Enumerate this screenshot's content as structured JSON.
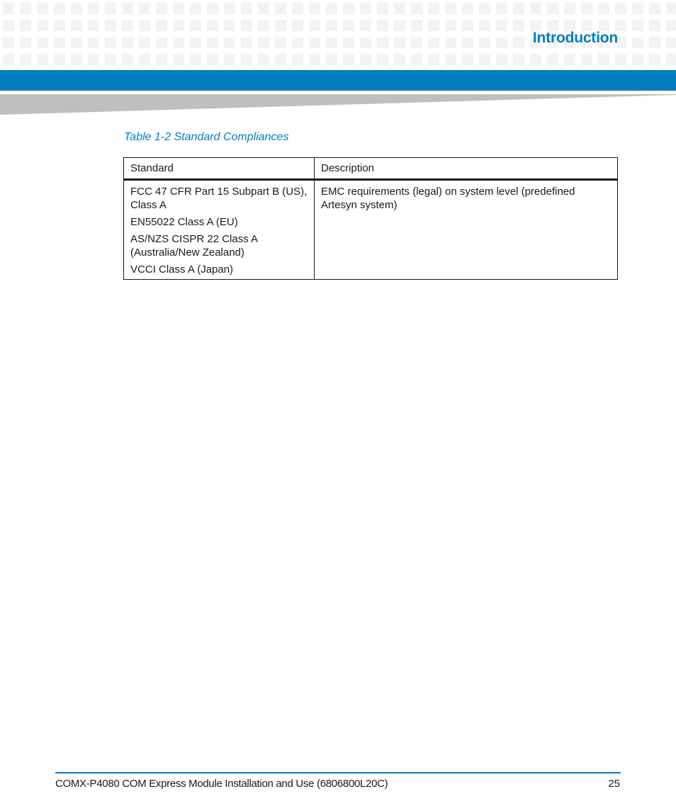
{
  "header": {
    "section_title": "Introduction",
    "colors": {
      "accent": "#027dbd",
      "swoosh": "#bebfc1",
      "grid_square": "#f3f3f3"
    }
  },
  "table": {
    "caption": "Table 1-2 Standard Compliances",
    "columns": [
      "Standard",
      "Description"
    ],
    "rows": [
      {
        "standards": [
          "FCC 47 CFR Part 15 Subpart B (US), Class A",
          "EN55022 Class A (EU)",
          "AS/NZS CISPR 22 Class A (Australia/New Zealand)",
          "VCCI Class A (Japan)"
        ],
        "description": "EMC requirements (legal) on system level (predefined Artesyn system)"
      }
    ]
  },
  "footer": {
    "document_title": "COMX-P4080 COM Express Module Installation and Use (6806800L20C)",
    "page_number": "25"
  }
}
